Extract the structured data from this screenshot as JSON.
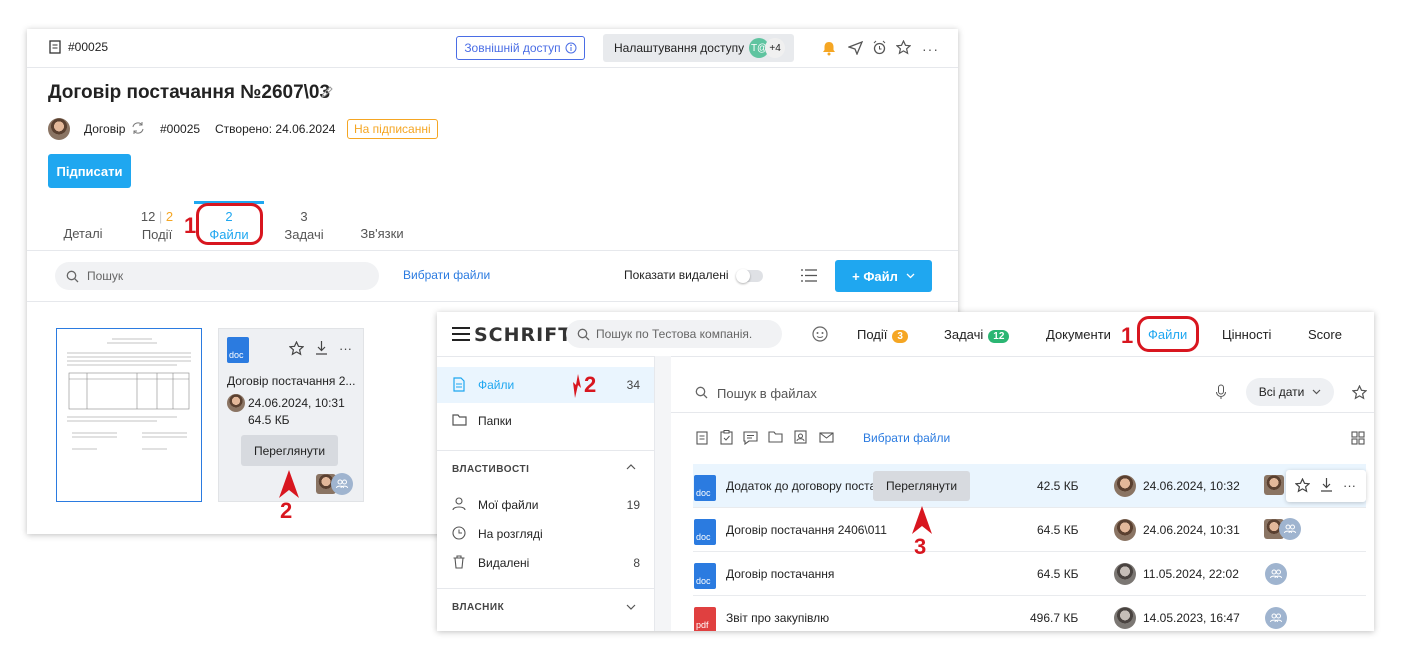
{
  "w1": {
    "doc_number": "#00025",
    "external_access": "Зовнішній доступ",
    "access_settings": "Налаштування доступу",
    "access_avatar": "T@",
    "access_more": "+4",
    "title": "Договір постачання №2607\\03",
    "meta_type": "Договір",
    "meta_number": "#00025",
    "meta_created": "Створено: 24.06.2024",
    "status": "На підписанні",
    "sign_button": "Підписати",
    "tabs": [
      {
        "label": "Деталі",
        "count": ""
      },
      {
        "label": "Події",
        "count_a": "12",
        "count_b": "2"
      },
      {
        "label": "Файли",
        "count": "2"
      },
      {
        "label": "Задачі",
        "count": "3"
      },
      {
        "label": "Зв'язки",
        "count": ""
      }
    ],
    "search_placeholder": "Пошук",
    "select_files": "Вибрати файли",
    "show_deleted": "Показати видалені",
    "add_file": "+ Файл",
    "card": {
      "type": "doc",
      "name": "Договір постачання 2...",
      "date": "24.06.2024, 10:31",
      "size": "64.5 КБ",
      "view": "Переглянути"
    }
  },
  "w2": {
    "logo": "SCHRIFT",
    "search_placeholder": "Пошук по Тестова компанія.",
    "nav": [
      {
        "label": "Події",
        "badge": "3",
        "color": "#f5a623"
      },
      {
        "label": "Задачі",
        "badge": "12",
        "color": "#2bb673"
      },
      {
        "label": "Документи",
        "badge": ""
      },
      {
        "label": "Файли",
        "badge": ""
      },
      {
        "label": "Цінності",
        "badge": ""
      },
      {
        "label": "Score",
        "badge": ""
      }
    ],
    "sidebar": {
      "files": "Файли",
      "files_count": "34",
      "folders": "Папки",
      "props_header": "ВЛАСТИВОСТІ",
      "my_files": "Мої файли",
      "my_files_count": "19",
      "review": "На розгляді",
      "deleted": "Видалені",
      "deleted_count": "8",
      "owner_header": "ВЛАСНИК"
    },
    "file_search_placeholder": "Пошук в файлах",
    "all_dates": "Всі дати",
    "select_files": "Вибрати файли",
    "view_tooltip": "Переглянути",
    "rows": [
      {
        "type": "doc",
        "name": "Додаток до договору поста",
        "size": "42.5 КБ",
        "date": "24.06.2024, 10:32"
      },
      {
        "type": "doc",
        "name": "Договір постачання 2406\\011",
        "size": "64.5 КБ",
        "date": "24.06.2024, 10:31"
      },
      {
        "type": "doc",
        "name": "Договір постачання",
        "size": "64.5 КБ",
        "date": "11.05.2024, 22:02"
      },
      {
        "type": "pdf",
        "name": "Звіт про закупівлю",
        "size": "496.7 КБ",
        "date": "14.05.2023, 16:47"
      }
    ]
  },
  "annotations": {
    "n1": "1",
    "n2": "2",
    "n3": "3"
  },
  "colors": {
    "accent": "#1fa7f0",
    "annotation": "#d8161f",
    "status": "#f5a623"
  }
}
